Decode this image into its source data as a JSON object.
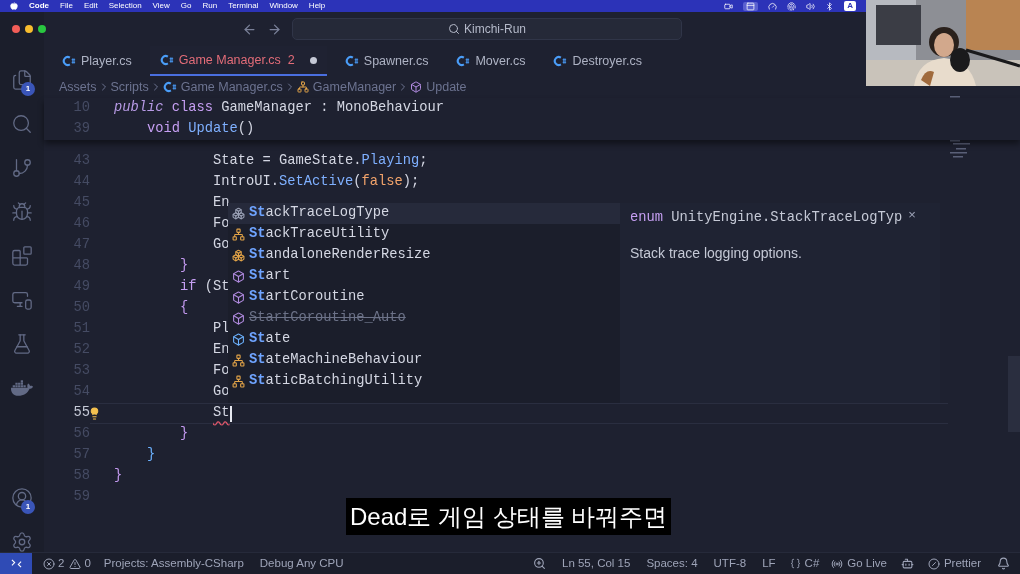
{
  "menu_bar": {
    "app": "Code",
    "items": [
      "File",
      "Edit",
      "Selection",
      "View",
      "Go",
      "Run",
      "Terminal",
      "Window",
      "Help"
    ],
    "input_source": "A"
  },
  "title_bar": {
    "search": "Kimchi-Run"
  },
  "activity_bar": {
    "top": [
      {
        "kind": "files",
        "badge": "1"
      },
      {
        "kind": "search"
      },
      {
        "kind": "source-control"
      },
      {
        "kind": "run-debug"
      },
      {
        "kind": "extensions"
      },
      {
        "kind": "remote"
      },
      {
        "kind": "testing"
      },
      {
        "kind": "docker"
      }
    ],
    "bottom": [
      {
        "kind": "account",
        "badge": "1"
      },
      {
        "kind": "settings"
      }
    ]
  },
  "tabs": [
    {
      "label": "Player.cs",
      "selected": false,
      "modified": false
    },
    {
      "label": "Game Manager.cs",
      "selected": true,
      "problems": "2",
      "modified": true
    },
    {
      "label": "Spawner.cs",
      "selected": false,
      "modified": false
    },
    {
      "label": "Mover.cs",
      "selected": false,
      "modified": false
    },
    {
      "label": "Destroyer.cs",
      "selected": false,
      "modified": false
    }
  ],
  "breadcrumbs": [
    {
      "kind": "folder",
      "label": "Assets"
    },
    {
      "kind": "folder",
      "label": "Scripts"
    },
    {
      "kind": "file",
      "label": "Game Manager.cs"
    },
    {
      "kind": "class",
      "label": "GameManager"
    },
    {
      "kind": "method",
      "label": "Update"
    }
  ],
  "editor": {
    "sticky_lines": [
      {
        "number": "10",
        "tokens": [
          {
            "kind": "modifier",
            "text": "public"
          },
          {
            "kind": "keyword",
            "text": " class"
          },
          {
            "kind": "plain",
            "text": " GameManager : MonoBehaviour"
          }
        ]
      },
      {
        "number": "39",
        "tokens": [
          {
            "kind": "keyword",
            "text": "    void"
          },
          {
            "kind": "method",
            "text": " Update"
          },
          {
            "kind": "plain",
            "text": "()"
          }
        ]
      }
    ],
    "lines": [
      {
        "number": "43",
        "current": false,
        "tokens": [
          {
            "kind": "plain",
            "text": "            State = GameState."
          },
          {
            "kind": "method",
            "text": "Playing"
          },
          {
            "kind": "plain",
            "text": ";"
          }
        ]
      },
      {
        "number": "44",
        "current": false,
        "tokens": [
          {
            "kind": "plain",
            "text": "            IntroUI."
          },
          {
            "kind": "method",
            "text": "SetActive"
          },
          {
            "kind": "plain",
            "text": "("
          },
          {
            "kind": "bool",
            "text": "false"
          },
          {
            "kind": "plain",
            "text": ");"
          }
        ]
      },
      {
        "number": "45",
        "current": false,
        "tokens": [
          {
            "kind": "plain",
            "text": "            En"
          }
        ]
      },
      {
        "number": "46",
        "current": false,
        "tokens": [
          {
            "kind": "plain",
            "text": "            Fo"
          }
        ]
      },
      {
        "number": "47",
        "current": false,
        "tokens": [
          {
            "kind": "plain",
            "text": "            Go"
          }
        ]
      },
      {
        "number": "48",
        "current": false,
        "tokens": [
          {
            "kind": "bracket_a",
            "text": "        }"
          }
        ]
      },
      {
        "number": "49",
        "current": false,
        "tokens": [
          {
            "kind": "keyword",
            "text": "        if"
          },
          {
            "kind": "plain",
            "text": " (St"
          }
        ]
      },
      {
        "number": "50",
        "current": false,
        "tokens": [
          {
            "kind": "bracket_a",
            "text": "        {"
          }
        ]
      },
      {
        "number": "51",
        "current": false,
        "tokens": [
          {
            "kind": "plain",
            "text": "            Pl"
          }
        ]
      },
      {
        "number": "52",
        "current": false,
        "tokens": [
          {
            "kind": "plain",
            "text": "            En"
          }
        ]
      },
      {
        "number": "53",
        "current": false,
        "tokens": [
          {
            "kind": "plain",
            "text": "            Fo"
          }
        ]
      },
      {
        "number": "54",
        "current": false,
        "tokens": [
          {
            "kind": "plain",
            "text": "            Go"
          }
        ]
      },
      {
        "number": "55",
        "current": true,
        "tokens": [
          {
            "kind": "error",
            "text": "            St"
          }
        ]
      },
      {
        "number": "56",
        "current": false,
        "tokens": [
          {
            "kind": "bracket_a",
            "text": "        }"
          }
        ]
      },
      {
        "number": "57",
        "current": false,
        "tokens": [
          {
            "kind": "bracket_b",
            "text": "    }"
          }
        ]
      },
      {
        "number": "58",
        "current": false,
        "tokens": [
          {
            "kind": "bracket_a",
            "text": "}"
          }
        ]
      },
      {
        "number": "59",
        "current": false
      }
    ],
    "suggest": {
      "items": [
        {
          "kind": "enum-plain",
          "label": "**St**ackTraceLogType",
          "selected": true,
          "deprecated": false
        },
        {
          "kind": "class",
          "label": "**St**ackTraceUtility",
          "selected": false,
          "deprecated": false
        },
        {
          "kind": "enum",
          "label": "**St**andaloneRenderResize",
          "selected": false,
          "deprecated": false
        },
        {
          "kind": "method",
          "label": "**St**art",
          "selected": false,
          "deprecated": false
        },
        {
          "kind": "method",
          "label": "**St**artCoroutine",
          "selected": false,
          "deprecated": false
        },
        {
          "kind": "method",
          "label": "StartCoroutine_Auto",
          "selected": false,
          "deprecated": true
        },
        {
          "kind": "field",
          "label": "**St**ate",
          "selected": false,
          "deprecated": false
        },
        {
          "kind": "class",
          "label": "**St**ateMachineBehaviour",
          "selected": false,
          "deprecated": false
        },
        {
          "kind": "class",
          "label": "**St**aticBatchingUtility",
          "selected": false,
          "deprecated": false
        }
      ],
      "detail": {
        "keyword": "enum",
        "signature": "UnityEngine.StackTraceLogTyp",
        "close": "×",
        "doc": "Stack trace logging options."
      }
    }
  },
  "subtitle": "Dead로 게임 상태를 바꿔주면",
  "status_bar": {
    "left": [
      {
        "kind": "remote"
      },
      {
        "kind": "problems",
        "errors": "2",
        "warnings": "0"
      },
      {
        "kind": "text",
        "text": "Projects: Assembly-CSharp"
      },
      {
        "kind": "text",
        "text": "Debug Any CPU"
      }
    ],
    "right": [
      {
        "kind": "zoom"
      },
      {
        "kind": "text",
        "text": "Ln 55, Col 15"
      },
      {
        "kind": "text",
        "text": "Spaces: 4"
      },
      {
        "kind": "text",
        "text": "UTF-8"
      },
      {
        "kind": "text",
        "text": "LF"
      },
      {
        "kind": "language",
        "text": "C#"
      },
      {
        "kind": "golive",
        "text": "Go Live"
      },
      {
        "kind": "copilot"
      },
      {
        "kind": "prettier",
        "text": "Prettier"
      },
      {
        "kind": "bell"
      }
    ]
  }
}
